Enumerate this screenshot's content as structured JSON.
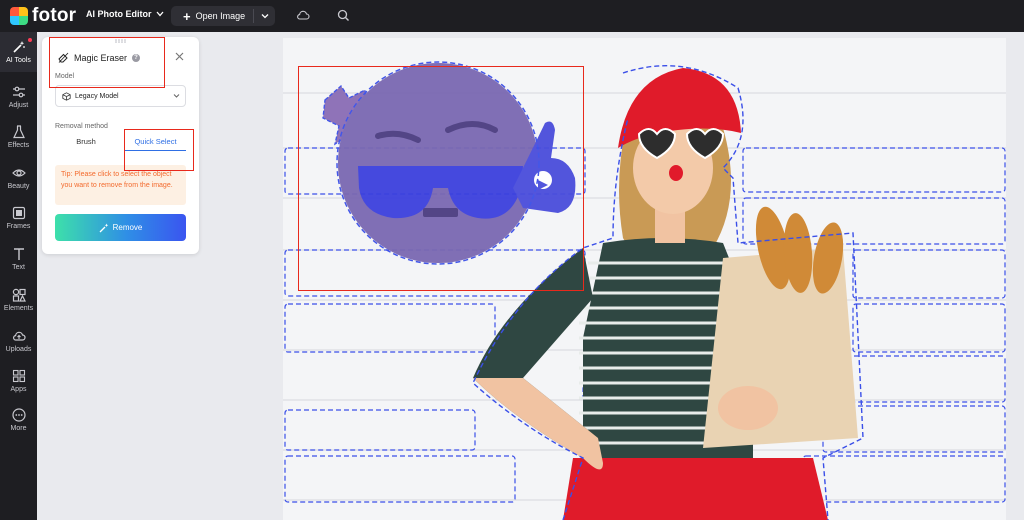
{
  "brand": {
    "name": "fotor"
  },
  "header": {
    "editor_menu": "AI Photo Editor",
    "open_image": "Open Image"
  },
  "rail": {
    "items": [
      {
        "label": "AI Tools",
        "icon": "magic-wand-icon",
        "active": true
      },
      {
        "label": "Adjust",
        "icon": "sliders-icon"
      },
      {
        "label": "Effects",
        "icon": "flask-icon"
      },
      {
        "label": "Beauty",
        "icon": "eye-icon"
      },
      {
        "label": "Frames",
        "icon": "frame-icon"
      },
      {
        "label": "Text",
        "icon": "text-icon"
      },
      {
        "label": "Elements",
        "icon": "shapes-icon"
      },
      {
        "label": "Uploads",
        "icon": "cloud-upload-icon"
      },
      {
        "label": "Apps",
        "icon": "apps-icon"
      },
      {
        "label": "More",
        "icon": "more-icon"
      }
    ]
  },
  "panel": {
    "title": "Magic Eraser",
    "model_label": "Model",
    "model_value": "Legacy Model",
    "removal_method_label": "Removal method",
    "tabs": {
      "brush": "Brush",
      "quick_select": "Quick Select"
    },
    "active_tab": "Quick Select",
    "tip": "Tip: Please click to select the object you want to remove from the image.",
    "remove_button": "Remove"
  },
  "colors": {
    "topbar": "#1e1e22",
    "accent_blue": "#2f6fe4",
    "tip_text": "#f36a2d",
    "tip_bg": "#fdf0e3",
    "highlight_red": "#e8291c",
    "selection_outline": "#3a4fe8"
  }
}
